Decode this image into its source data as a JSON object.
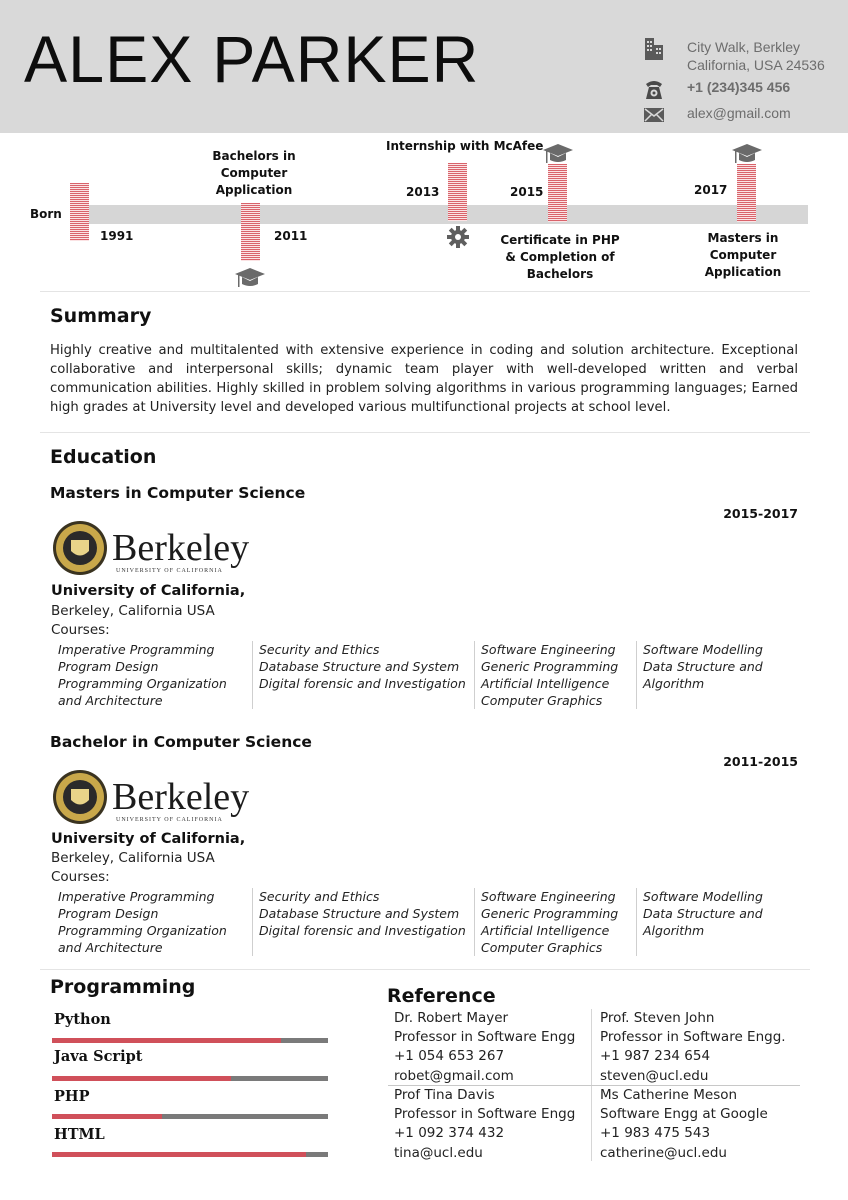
{
  "header": {
    "name": "ALEX PARKER",
    "contact": [
      {
        "icon": "building-icon",
        "lines": [
          "City Walk, Berkley",
          "California, USA 24536"
        ]
      },
      {
        "icon": "phone-icon",
        "lines": [
          "+1 (234)345 456"
        ]
      },
      {
        "icon": "envelope-icon",
        "lines": [
          "alex@gmail.com"
        ]
      }
    ]
  },
  "timeline": {
    "events": [
      {
        "label": "Born",
        "year": "1991"
      },
      {
        "label": "Bachelors in Computer Application",
        "label_lines": [
          "Bachelors in",
          "Computer",
          "Application"
        ],
        "year": "2011",
        "icon": "graduation-cap-icon"
      },
      {
        "label": "Internship with McAfee",
        "year": "2013",
        "icon": "gear-icon"
      },
      {
        "label": "Certificate in PHP & Completion of Bachelors",
        "label_lines": [
          "Certificate in PHP",
          "& Completion of",
          "Bachelors"
        ],
        "year": "2015",
        "icon": "graduation-cap-icon"
      },
      {
        "label": "Masters in Computer Application",
        "label_lines": [
          "Masters in",
          "Computer",
          "Application"
        ],
        "year": "2017",
        "icon": "graduation-cap-icon"
      }
    ],
    "colors": {
      "marker": "#d9636b",
      "bar": "#d6d6d6"
    }
  },
  "summary": {
    "heading": "Summary",
    "text": "Highly creative and multitalented with extensive experience in coding and solution architecture. Exceptional collaborative and interpersonal skills; dynamic team player with well-developed written and verbal communication abilities. Highly skilled in problem solving algorithms in various programming languages; Earned high grades at University level and developed various multifunctional projects at school level."
  },
  "education": {
    "heading": "Education",
    "entries": [
      {
        "degree": "Masters in Computer Science",
        "years": "2015-2017",
        "logo_text": "Berkeley",
        "logo_subtext": "UNIVERSITY OF CALIFORNIA",
        "university": "University of California,",
        "location": "Berkeley, California USA",
        "courses_label": "Courses:",
        "course_columns": [
          [
            "Imperative Programming",
            "Program Design",
            "Programming Organization",
            "and Architecture"
          ],
          [
            "Security and Ethics",
            "Database Structure and System",
            "Digital forensic and Investigation"
          ],
          [
            "Software Engineering",
            "Generic Programming",
            "Artificial Intelligence",
            "Computer Graphics"
          ],
          [
            "Software Modelling",
            "Data Structure and",
            "Algorithm"
          ]
        ]
      },
      {
        "degree": "Bachelor in Computer Science",
        "years": "2011-2015",
        "logo_text": "Berkeley",
        "logo_subtext": "UNIVERSITY OF CALIFORNIA",
        "university": "University of California,",
        "location": "Berkeley, California USA",
        "courses_label": "Courses:",
        "course_columns": [
          [
            "Imperative Programming",
            "Program Design",
            "Programming Organization",
            "and Architecture"
          ],
          [
            "Security and Ethics",
            "Database Structure and System",
            "Digital forensic and Investigation"
          ],
          [
            "Software Engineering",
            "Generic Programming",
            "Artificial Intelligence",
            "Computer Graphics"
          ],
          [
            "Software Modelling",
            "Data Structure and",
            "Algorithm"
          ]
        ]
      }
    ]
  },
  "programming": {
    "heading": "Programming",
    "skills": [
      {
        "name": "Python",
        "level": 0.83
      },
      {
        "name": "Java Script",
        "level": 0.65
      },
      {
        "name": "PHP",
        "level": 0.4
      },
      {
        "name": "HTML",
        "level": 0.92
      }
    ],
    "colors": {
      "fill": "#d0505a",
      "track": "#7a7a7a"
    }
  },
  "reference": {
    "heading": "Reference",
    "people": [
      {
        "name": "Dr. Robert Mayer",
        "title": "Professor in Software Engg",
        "phone": "+1 054 653 267",
        "email": "robet@gmail.com"
      },
      {
        "name": "Prof. Steven John",
        "title": "Professor in Software Engg.",
        "phone": "+1 987 234 654",
        "email": "steven@ucl.edu"
      },
      {
        "name": "Prof Tina Davis",
        "title": "Professor in Software Engg",
        "phone": "+1 092 374 432",
        "email": "tina@ucl.edu"
      },
      {
        "name": "Ms Catherine Meson",
        "title": "Software Engg at Google",
        "phone": "+1 983 475 543",
        "email": "catherine@ucl.edu"
      }
    ]
  }
}
